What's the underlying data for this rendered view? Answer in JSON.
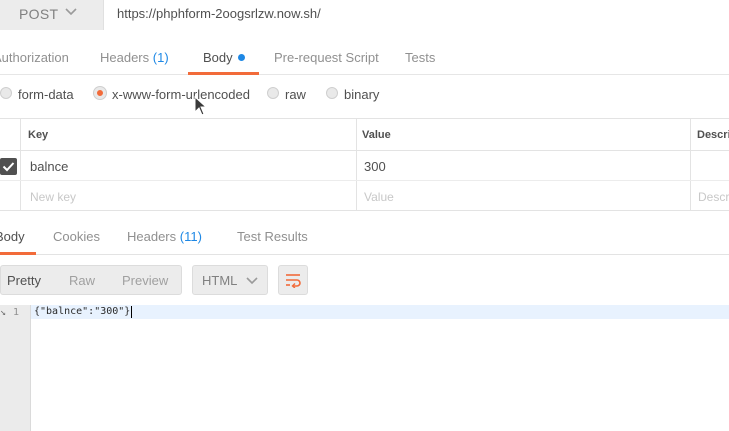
{
  "request": {
    "method": "POST",
    "url": "https://phphform-2oogsrlzw.now.sh/"
  },
  "request_tabs": [
    {
      "label": "Authorization",
      "count": ""
    },
    {
      "label": "Headers",
      "count": "(1)"
    },
    {
      "label": "Body",
      "count": ""
    },
    {
      "label": "Pre-request Script",
      "count": ""
    },
    {
      "label": "Tests",
      "count": ""
    }
  ],
  "body_types": [
    {
      "label": "form-data",
      "selected": false
    },
    {
      "label": "x-www-form-urlencoded",
      "selected": true
    },
    {
      "label": "raw",
      "selected": false
    },
    {
      "label": "binary",
      "selected": false
    }
  ],
  "params_table": {
    "headers": [
      "Key",
      "Value",
      "Descrip"
    ],
    "rows": [
      {
        "key": "balnce",
        "value": "300",
        "checked": true
      }
    ],
    "new_row": {
      "key_placeholder": "New key",
      "value_placeholder": "Value",
      "desc_placeholder": "Descr"
    }
  },
  "response_tabs": [
    {
      "label": "Body",
      "count": ""
    },
    {
      "label": "Cookies",
      "count": ""
    },
    {
      "label": "Headers",
      "count": "(11)"
    },
    {
      "label": "Test Results",
      "count": ""
    }
  ],
  "view_modes": [
    "Pretty",
    "Raw",
    "Preview"
  ],
  "format": "HTML",
  "response_code": {
    "fold_marker": "↘",
    "line_number": "1",
    "line": "{\"balnce\":\"300\"}"
  },
  "colors": {
    "accent": "#f26b3a",
    "count_blue": "#1e88e5"
  }
}
